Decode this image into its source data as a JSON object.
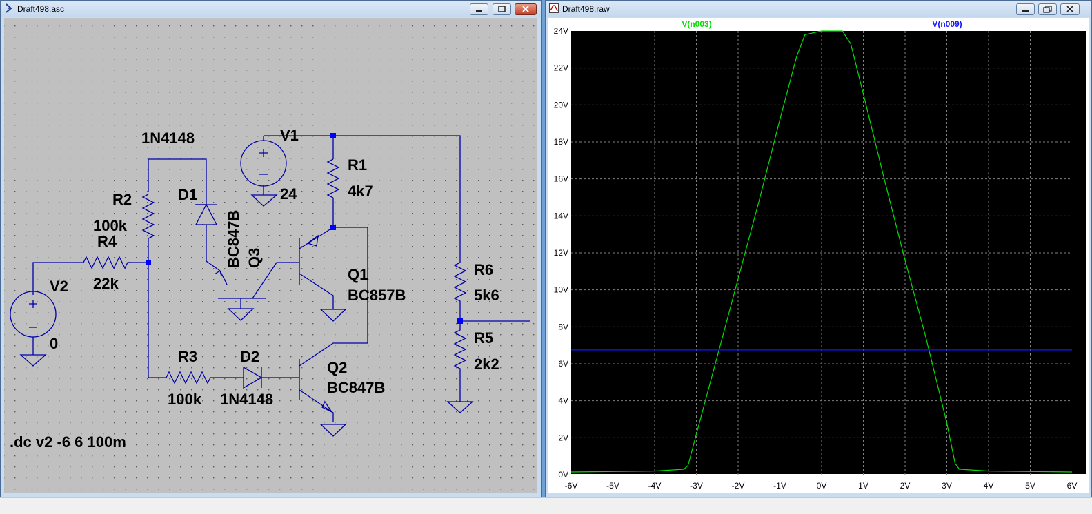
{
  "schematic": {
    "title": "Draft498.asc",
    "labels": {
      "d1_model": "1N4148",
      "d1_name": "D1",
      "v1_name": "V1",
      "v1_value": "24",
      "r1_name": "R1",
      "r1_value": "4k7",
      "r2_name": "R2",
      "r2_value": "100k",
      "r4_name": "R4",
      "r4_value": "22k",
      "v2_name": "V2",
      "v2_value": "0",
      "q3_model": "BC847B",
      "q3_name": "Q3",
      "q1_name": "Q1",
      "q1_model": "BC857B",
      "r6_name": "R6",
      "r6_value": "5k6",
      "r5_name": "R5",
      "r5_value": "2k2",
      "r3_name": "R3",
      "r3_value": "100k",
      "d2_name": "D2",
      "d2_model": "1N4148",
      "q2_name": "Q2",
      "q2_model": "BC847B",
      "directive": ".dc v2 -6 6 100m"
    }
  },
  "plot": {
    "title": "Draft498.raw",
    "colors": {
      "background": "#000000",
      "grid": "#808080",
      "trace1": "#00e000",
      "trace2": "#1414ff",
      "axis_text": "#000000"
    },
    "chart_data": {
      "type": "line",
      "series": [
        {
          "name": "V(n003)",
          "x": [
            -6,
            -4,
            -3.3,
            -3.2,
            -3.0,
            -2.5,
            -2.0,
            -1.5,
            -1.0,
            -0.6,
            -0.4,
            0.0,
            0.5,
            0.7,
            1.0,
            1.5,
            2.0,
            2.5,
            3.0,
            3.2,
            3.3,
            4,
            6
          ],
          "y": [
            0.15,
            0.2,
            0.3,
            0.5,
            2.2,
            6.4,
            10.6,
            14.8,
            19.2,
            22.6,
            23.8,
            24,
            24,
            23.3,
            20.6,
            16.0,
            11.6,
            7.4,
            2.8,
            0.6,
            0.3,
            0.2,
            0.15
          ]
        },
        {
          "name": "V(n009)",
          "x": [
            -6,
            6
          ],
          "y": [
            6.75,
            6.75
          ]
        }
      ],
      "xlim": [
        -6,
        6
      ],
      "ylim": [
        0,
        24
      ],
      "x_ticks": [
        "-6V",
        "-5V",
        "-4V",
        "-3V",
        "-2V",
        "-1V",
        "0V",
        "1V",
        "2V",
        "3V",
        "4V",
        "5V",
        "6V"
      ],
      "y_ticks": [
        "0V",
        "2V",
        "4V",
        "6V",
        "8V",
        "10V",
        "12V",
        "14V",
        "16V",
        "18V",
        "20V",
        "22V",
        "24V"
      ],
      "grid": true
    }
  }
}
